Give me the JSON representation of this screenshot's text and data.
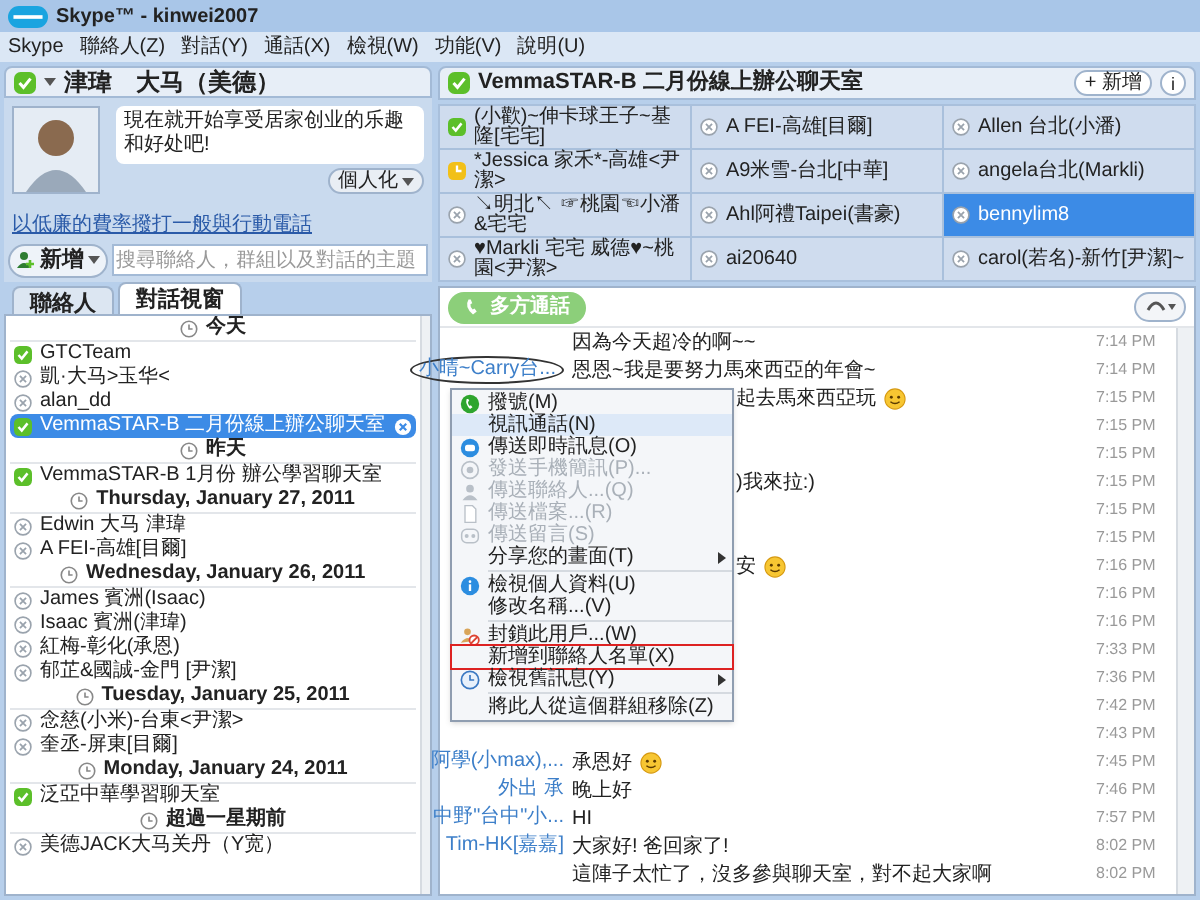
{
  "window": {
    "title": "Skype™ - kinwei2007"
  },
  "menu": [
    "Skype",
    "聯絡人(Z)",
    "對話(Y)",
    "通話(X)",
    "檢視(W)",
    "功能(V)",
    "說明(U)"
  ],
  "profile": {
    "name": "津瑋　大马（美德）",
    "mood": "現在就开始享受居家创业的乐趣和好处吧!",
    "personalize": "個人化",
    "call_link": "以低廉的費率撥打一般與行動電話"
  },
  "add_button": "新增",
  "search": {
    "placeholder": "搜尋聯絡人，群組以及對話的主題"
  },
  "tabs": [
    {
      "label": "聯絡人",
      "selected": false
    },
    {
      "label": "對話視窗",
      "selected": true
    }
  ],
  "conversations": [
    {
      "kind": "header",
      "label": "今天"
    },
    {
      "kind": "online",
      "label": "GTCTeam",
      "selected": false
    },
    {
      "kind": "offline",
      "label": "凱·大马>玉华<",
      "selected": false
    },
    {
      "kind": "offline",
      "label": "alan_dd",
      "selected": false
    },
    {
      "kind": "group",
      "label": "VemmaSTAR-B 二月份線上辦公聊天室",
      "selected": true
    },
    {
      "kind": "header",
      "label": "昨天"
    },
    {
      "kind": "group",
      "label": "VemmaSTAR-B 1月份 辦公學習聊天室",
      "selected": false
    },
    {
      "kind": "header",
      "label": "Thursday, January 27, 2011"
    },
    {
      "kind": "offline",
      "label": "Edwin 大马 津瑋",
      "selected": false
    },
    {
      "kind": "offline",
      "label": "A FEI-高雄[目爾]",
      "selected": false
    },
    {
      "kind": "header",
      "label": "Wednesday, January 26, 2011"
    },
    {
      "kind": "offline",
      "label": "James 賓洲(Isaac)",
      "selected": false
    },
    {
      "kind": "offline",
      "label": "Isaac 賓洲(津瑋)",
      "selected": false
    },
    {
      "kind": "offline",
      "label": "紅梅-彰化(承恩)",
      "selected": false
    },
    {
      "kind": "offline",
      "label": "郁芷&國誠-金門 [尹潔]",
      "selected": false
    },
    {
      "kind": "header",
      "label": "Tuesday, January 25, 2011"
    },
    {
      "kind": "offline",
      "label": "念慈(小米)-台東<尹潔>",
      "selected": false
    },
    {
      "kind": "offline",
      "label": "奎丞-屏東[目爾]",
      "selected": false
    },
    {
      "kind": "header",
      "label": "Monday, January 24, 2011"
    },
    {
      "kind": "group",
      "label": "泛亞中華學習聊天室",
      "selected": false
    },
    {
      "kind": "header",
      "label": "超過一星期前"
    },
    {
      "kind": "offline",
      "label": "美德JACK大马关丹（Y宽）",
      "selected": false
    }
  ],
  "chat": {
    "title": "VemmaSTAR-B 二月份線上辦公聊天室",
    "add_button": "+ 新增",
    "info_button": "i",
    "call_button": "多方通話"
  },
  "participants": [
    {
      "kind": "online",
      "name": "(小歡)~伸卡球王子~基隆[宅宅]",
      "selected": false
    },
    {
      "kind": "offline",
      "name": "A FEI-高雄[目爾]",
      "selected": false
    },
    {
      "kind": "offline",
      "name": "Allen 台北(小潘)",
      "selected": false
    },
    {
      "kind": "away",
      "name": "*Jessica 家禾*-高雄<尹潔>",
      "selected": false
    },
    {
      "kind": "offline",
      "name": "A9米雪-台北[中華]",
      "selected": false
    },
    {
      "kind": "offline",
      "name": "angela台北(Markli)",
      "selected": false
    },
    {
      "kind": "offline",
      "name": "↘明北↖ ☞桃園☜小潘&宅宅",
      "selected": false
    },
    {
      "kind": "offline",
      "name": "Ahl阿禮Taipei(書豪)",
      "selected": false
    },
    {
      "kind": "offline",
      "name": "bennylim8",
      "selected": true
    },
    {
      "kind": "offline",
      "name": "♥Markli 宅宅 威德♥~桃園<尹潔>",
      "selected": false
    },
    {
      "kind": "offline",
      "name": "ai20640",
      "selected": false
    },
    {
      "kind": "offline",
      "name": "carol(若名)-新竹[尹潔]~",
      "selected": false
    }
  ],
  "messages": [
    {
      "text": "因為今天超冷的啊~~",
      "time": "7:14 PM"
    },
    {
      "sender": "小晴~Carry台...",
      "text": "恩恩~我是要努力馬來西亞的年會~",
      "time": "7:14 PM"
    },
    {
      "text": "起去馬來西亞玩",
      "covered": true,
      "emoji": true,
      "time": "7:15 PM"
    },
    {
      "time": "7:15 PM"
    },
    {
      "time": "7:15 PM"
    },
    {
      "text": ")我來拉:)",
      "covered": true,
      "time": "7:15 PM"
    },
    {
      "time": "7:15 PM"
    },
    {
      "time": "7:15 PM"
    },
    {
      "text": "安",
      "covered": true,
      "emoji": true,
      "time": "7:16 PM"
    },
    {
      "time": "7:16 PM"
    },
    {
      "time": "7:16 PM"
    },
    {
      "time": "7:33 PM"
    },
    {
      "time": "7:36 PM"
    },
    {
      "time": "7:42 PM"
    },
    {
      "time": "7:43 PM"
    },
    {
      "sender": "阿學(小max),...",
      "text": "承恩好",
      "emoji": true,
      "time": "7:45 PM"
    },
    {
      "sender": "外出 承",
      "text": "晚上好",
      "time": "7:46 PM"
    },
    {
      "sender": "中野\"台中\"小...",
      "text": "HI",
      "time": "7:57 PM"
    },
    {
      "sender": "Tim-HK[嘉嘉]",
      "text": "大家好! 爸回家了!",
      "time": "8:02 PM"
    },
    {
      "text": "這陣子太忙了，沒多參與聊天室，對不起大家啊",
      "time": "8:02 PM"
    }
  ],
  "context_menu": [
    {
      "kind": "item",
      "label": "撥號(M)",
      "disabled": false,
      "selected": false,
      "submenu": false,
      "outlined": false
    },
    {
      "kind": "item",
      "label": "視訊通話(N)",
      "disabled": false,
      "selected": true,
      "submenu": false,
      "outlined": false
    },
    {
      "kind": "item",
      "label": "傳送即時訊息(O)",
      "disabled": false,
      "selected": false,
      "submenu": false,
      "outlined": false
    },
    {
      "kind": "item",
      "label": "發送手機簡訊(P)...",
      "disabled": true,
      "selected": false,
      "submenu": false,
      "outlined": false
    },
    {
      "kind": "item",
      "label": "傳送聯絡人...(Q)",
      "disabled": true,
      "selected": false,
      "submenu": false,
      "outlined": false
    },
    {
      "kind": "item",
      "label": "傳送檔案...(R)",
      "disabled": true,
      "selected": false,
      "submenu": false,
      "outlined": false
    },
    {
      "kind": "item",
      "label": "傳送留言(S)",
      "disabled": true,
      "selected": false,
      "submenu": false,
      "outlined": false
    },
    {
      "kind": "item",
      "label": "分享您的畫面(T)",
      "disabled": false,
      "selected": false,
      "submenu": true,
      "outlined": false
    },
    {
      "kind": "separator"
    },
    {
      "kind": "item",
      "label": "檢視個人資料(U)",
      "disabled": false,
      "selected": false,
      "submenu": false,
      "outlined": false
    },
    {
      "kind": "item",
      "label": "修改名稱...(V)",
      "disabled": false,
      "selected": false,
      "submenu": false,
      "outlined": false
    },
    {
      "kind": "separator"
    },
    {
      "kind": "item",
      "label": "封鎖此用戶...(W)",
      "disabled": false,
      "selected": false,
      "submenu": false,
      "outlined": false
    },
    {
      "kind": "item",
      "label": "新增到聯絡人名單(X)",
      "disabled": false,
      "selected": false,
      "submenu": false,
      "outlined": true
    },
    {
      "kind": "item",
      "label": "檢視舊訊息(Y)",
      "disabled": false,
      "selected": false,
      "submenu": true,
      "outlined": false
    },
    {
      "kind": "separator"
    },
    {
      "kind": "item",
      "label": "將此人從這個群組移除(Z)",
      "disabled": false,
      "selected": false,
      "submenu": false,
      "outlined": false
    }
  ]
}
